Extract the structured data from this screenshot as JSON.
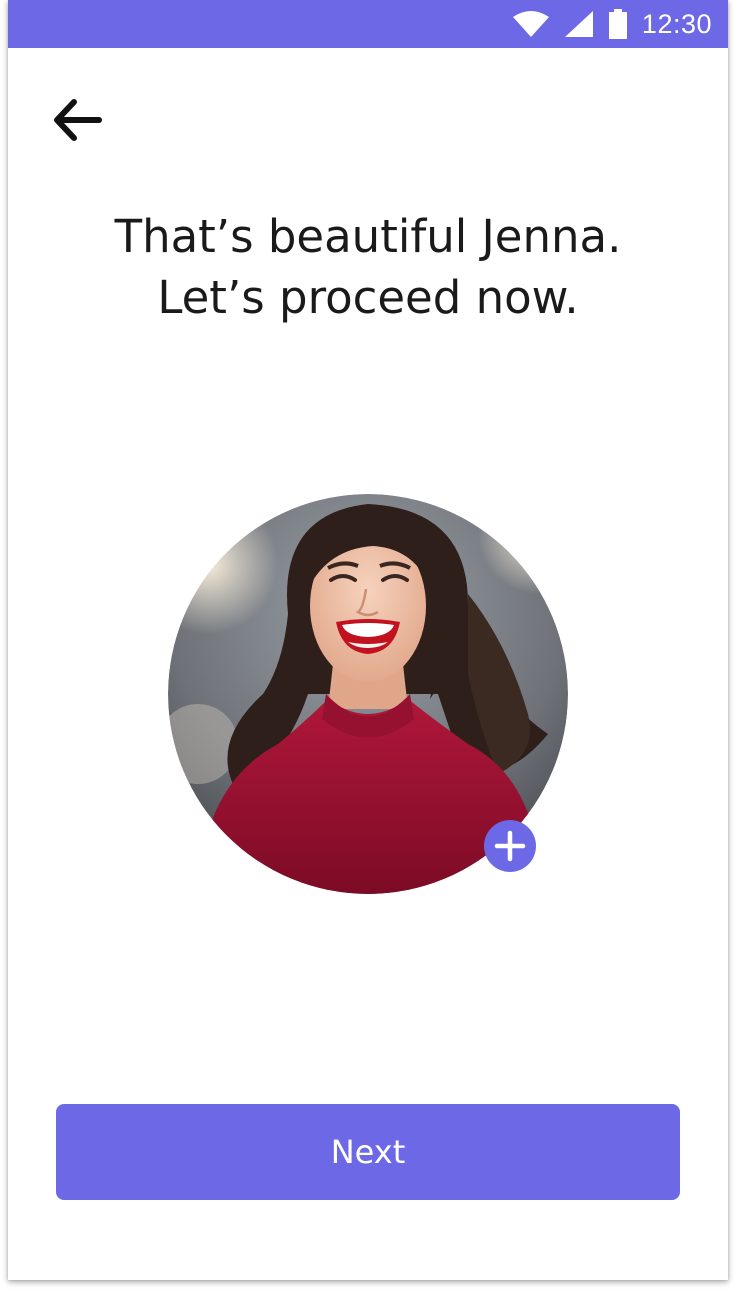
{
  "status_bar": {
    "time": "12:30",
    "icons": [
      "wifi-icon",
      "cellular-signal-icon",
      "battery-icon"
    ],
    "background": "#6d69e6"
  },
  "header": {
    "back_icon": "arrow-left-icon"
  },
  "main": {
    "title_line_1": "That’s beautiful Jenna.",
    "title_line_2": "Let’s proceed now.",
    "profile_photo": "profile-photo",
    "add_photo_icon": "plus-icon"
  },
  "footer": {
    "next_label": "Next"
  },
  "colors": {
    "accent": "#6d69e6",
    "text": "#1a1a1a",
    "background": "#ffffff"
  }
}
